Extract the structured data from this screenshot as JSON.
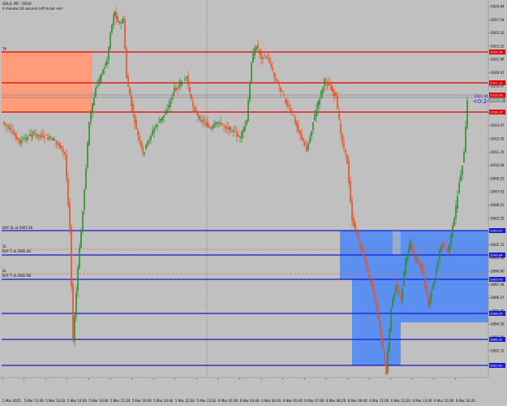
{
  "window": {
    "title": "GOLD, M5 - GOLD",
    "countdown": "0 minutes 24 seconds left to bar end"
  },
  "price_axis": {
    "labels": [
      "2929.84",
      "2927.54",
      "2925.10",
      "2923.22",
      "2922.89",
      "2920.47",
      "2919.07",
      "2917.85",
      "2916.21",
      "2914.07",
      "2912.42",
      "2911.25",
      "2910.04",
      "2909.23",
      "2907.61",
      "2906.15",
      "2903.25",
      "2902.08",
      "2901.72",
      "2900.48",
      "2898.60",
      "2897.44",
      "2896.27",
      "2895.80",
      "2894.30",
      "2893.38",
      "2892.31"
    ],
    "tags": {
      "red_top": "2924.44",
      "red_mid": "2921.11",
      "bid": "2919.56",
      "ask": "2919.56",
      "red_low": "2918.37",
      "blue_1": "2909.07",
      "blue_2": "2906.84",
      "blue_3": "2903.43",
      "blue_4": "2898.04",
      "blue_5": "2896.31",
      "blue_6": "2893.60"
    }
  },
  "time_axis": {
    "labels": [
      "5 Mar 2025",
      "5 Mar 12:40",
      "5 Mar 13:20",
      "5 Mar 14:00",
      "5 Mar 14:40",
      "5 Mar 15:20",
      "5 Mar 16:00",
      "5 Mar 20:40",
      "5 Mar 22:00",
      "5 Mar 23:20",
      "6 Mar 01:00",
      "6 Mar 03:00",
      "6 Mar 04:20",
      "6 Mar 05:40",
      "6 Mar 07:00",
      "6 Mar 08:20",
      "6 Mar 09:40",
      "6 Mar 11:00",
      "6 Mar 12:20",
      "6 Mar 13:40",
      "6 Mar 15:00",
      "6 Mar 16:20"
    ]
  },
  "annotations": {
    "tp_label": "TP",
    "buy_sl_label": "BUY SL at 2907.46",
    "buy1_label": "BUY T at 2905.44",
    "buy2_label": "BUY T at 2902.98",
    "sl_label_1": "SL",
    "sl_label_2": "SL",
    "countdown_timer": "<0:24",
    "price_near_tag": "2921.94"
  },
  "colors": {
    "background": "#c0c0c0",
    "bull": "#2e8b2e",
    "bear": "#e8501f",
    "level_red": "#e00000",
    "level_blue": "#1818d0",
    "zone_orange": "#ff9c7a",
    "zone_blue": "#5b8ff0",
    "grid": "#8c8c8c",
    "dashed_red": "#d07070"
  }
}
